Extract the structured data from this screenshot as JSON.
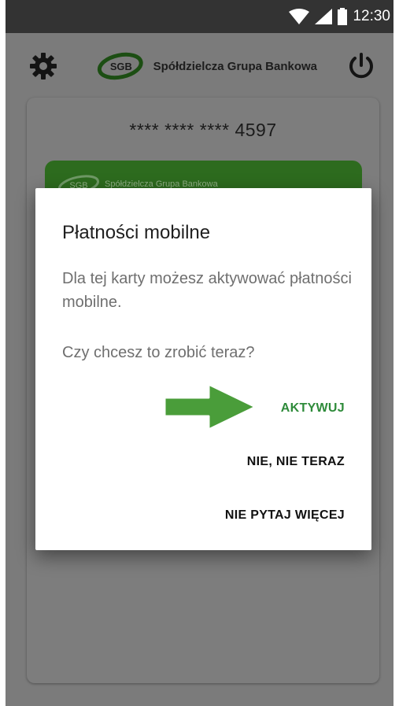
{
  "status_bar": {
    "time": "12:30",
    "icons": [
      "wifi-icon",
      "signal-icon",
      "battery-icon"
    ]
  },
  "app_bar": {
    "brand_abbr": "SGB",
    "brand_name": "Spółdzielcza Grupa Bankowa",
    "icons": [
      "gear-icon",
      "power-icon"
    ]
  },
  "card": {
    "masked_number": "**** **** **** 4597",
    "visual_text": "Spółdzielcza Grupa Bankowa",
    "visual_logo": "SGB"
  },
  "dialog": {
    "title": "Płatności mobilne",
    "message": "Dla tej karty możesz aktywować płatności mobilne.",
    "question": "Czy chcesz to zrobić teraz?",
    "buttons": {
      "activate": "AKTYWUJ",
      "not_now": "NIE, NIE TERAZ",
      "never": "NIE PYTAJ WIĘCEJ"
    }
  },
  "colors": {
    "accent_green": "#2e8b3a",
    "arrow_green": "#4a9d3a",
    "status_bar": "#333333",
    "scrim": "#7b7b7b"
  }
}
